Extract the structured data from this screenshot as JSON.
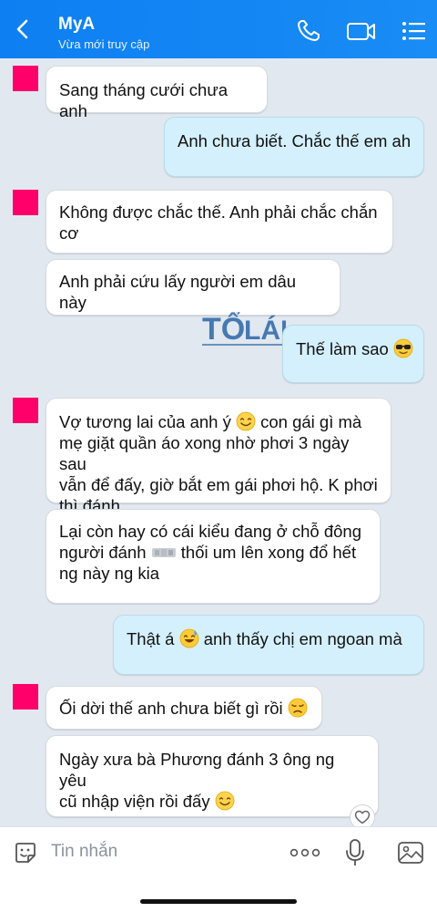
{
  "header": {
    "title": "MyA",
    "status": "Vừa mới truy cập",
    "accent": "#0d7ff2"
  },
  "messages": [
    {
      "side": "in",
      "text": "Sang tháng cưới chưa anh"
    },
    {
      "side": "out",
      "text": "Anh chưa biết. Chắc thế em ah"
    },
    {
      "side": "in",
      "line1": "Không được chắc thế. Anh phải chắc chắn",
      "line2": "cơ"
    },
    {
      "side": "in",
      "text": "Anh phải cứu lấy người em dâu này"
    },
    {
      "side": "out",
      "text": "Thế làm sao",
      "emoji": "sunglasses-emoji"
    },
    {
      "side": "in",
      "line1a": "Vợ tương lai của anh ý",
      "line1b": "con gái gì mà",
      "line2": "mẹ giặt quần áo xong nhờ phơi 3 ngày sau",
      "line3": "vẫn để đấy, giờ bắt em gái phơi hộ. K phơi",
      "line4": "thì đánh",
      "emoji": "smile-emoji"
    },
    {
      "side": "in",
      "line1": "Lại còn hay có cái kiểu đang ở chỗ đông",
      "line2a": "người đánh",
      "line2b": "thối um lên xong đổ hết",
      "line3": "ng này ng kia"
    },
    {
      "side": "out",
      "part1": "Thật á",
      "part2": "anh thấy chị em ngoan mà",
      "emoji": "sweat-smile-emoji"
    },
    {
      "side": "in",
      "text": "Ối dời thế anh chưa biết gì rồi",
      "emoji": "disappointed-emoji"
    },
    {
      "side": "in",
      "line1": "Ngày xưa bà Phương đánh 3 ông ng yêu",
      "line2": "cũ nhập viện rồi đấy",
      "emoji": "smile-emoji"
    }
  ],
  "watermark": {
    "line1": "TỔ",
    "line2": "LÁI"
  },
  "input": {
    "placeholder": "Tin nhắn"
  },
  "icons": [
    "back-icon",
    "phone-icon",
    "video-icon",
    "menu-icon",
    "sticker-icon",
    "more-icon",
    "mic-icon",
    "image-icon",
    "heart-icon"
  ]
}
